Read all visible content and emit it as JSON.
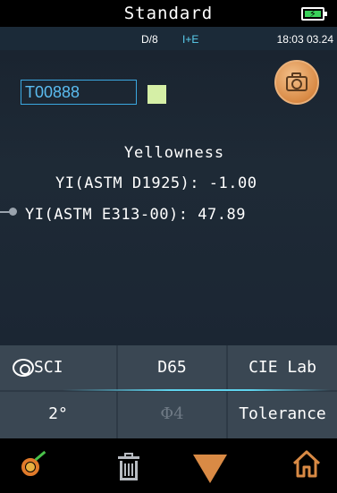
{
  "header": {
    "title": "Standard",
    "battery_icon": "battery-charging-icon"
  },
  "status": {
    "geometry": "D/8",
    "mode": "I+E",
    "datetime": "18:03 03.24"
  },
  "sample": {
    "name": "T00888",
    "swatch_color": "#d5efa6"
  },
  "camera": {
    "icon": "camera-icon"
  },
  "results": {
    "heading": "Yellowness",
    "rows": [
      {
        "label": "YI(ASTM D1925):",
        "value": "-1.00"
      },
      {
        "label": "YI(ASTM E313-00):",
        "value": "47.89"
      }
    ]
  },
  "buttons": {
    "sci": "SCI",
    "illuminant": "D65",
    "color_space": "CIE Lab",
    "observer": "2°",
    "aperture": "Φ4",
    "tolerance": "Tolerance"
  },
  "bottom_nav": {
    "measure_icon": "target-icon",
    "delete_icon": "trash-icon",
    "down_icon": "down-arrow-icon",
    "home_icon": "home-icon"
  },
  "colors": {
    "accent_cyan": "#5fd4ee",
    "accent_orange": "#d98a45",
    "sample_blue": "#3aa7e0"
  }
}
